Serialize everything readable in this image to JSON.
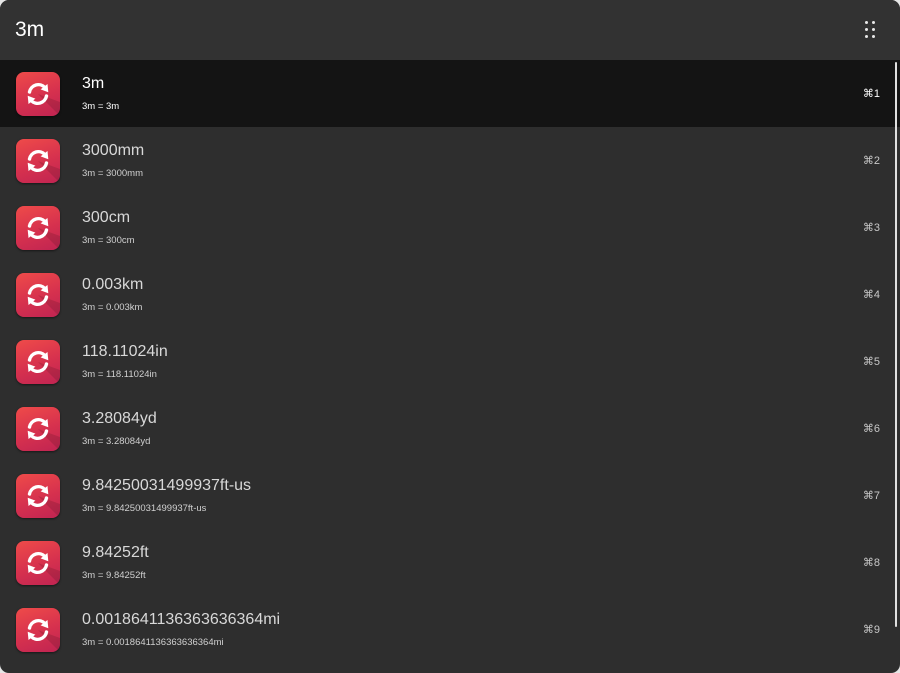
{
  "search": {
    "query": "3m"
  },
  "results": [
    {
      "title": "3m",
      "subtitle": "3m = 3m",
      "shortcut": "⌘1",
      "icon": "convert-icon"
    },
    {
      "title": "3000mm",
      "subtitle": "3m = 3000mm",
      "shortcut": "⌘2",
      "icon": "convert-icon"
    },
    {
      "title": "300cm",
      "subtitle": "3m = 300cm",
      "shortcut": "⌘3",
      "icon": "convert-icon"
    },
    {
      "title": "0.003km",
      "subtitle": "3m = 0.003km",
      "shortcut": "⌘4",
      "icon": "convert-icon"
    },
    {
      "title": "118.11024in",
      "subtitle": "3m = 118.11024in",
      "shortcut": "⌘5",
      "icon": "convert-icon"
    },
    {
      "title": "3.28084yd",
      "subtitle": "3m = 3.28084yd",
      "shortcut": "⌘6",
      "icon": "convert-icon"
    },
    {
      "title": "9.84250031499937ft-us",
      "subtitle": "3m = 9.84250031499937ft-us",
      "shortcut": "⌘7",
      "icon": "convert-icon"
    },
    {
      "title": "9.84252ft",
      "subtitle": "3m = 9.84252ft",
      "shortcut": "⌘8",
      "icon": "convert-icon"
    },
    {
      "title": "0.0018641136363636364mi",
      "subtitle": "3m = 0.0018641136363636364mi",
      "shortcut": "⌘9",
      "icon": "convert-icon"
    }
  ],
  "selected_index": 0,
  "colors": {
    "window_bg": "#2e2e2e",
    "selected_row_bg": "#141414",
    "icon_gradient_top": "#ef4b49",
    "icon_gradient_bottom": "#c02452"
  }
}
